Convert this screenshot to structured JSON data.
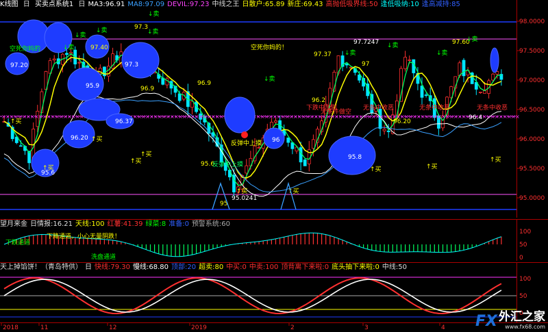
{
  "main_header": {
    "window_title": "K线图",
    "period": "日",
    "indicator_name": "买卖点系统1",
    "items": [
      {
        "text": "日",
        "color": "#dddddd"
      },
      {
        "text": "MA3:96.91",
        "color": "#ffffff"
      },
      {
        "text": "MA8:97.09",
        "color": "#3aa0ff"
      },
      {
        "text": "DEVIL:97.23",
        "color": "#ff44ff"
      },
      {
        "text": "中线之王",
        "color": "#dddddd"
      },
      {
        "text": "日散户:65.89",
        "color": "#ffff00"
      },
      {
        "text": "新庄:69.43",
        "color": "#ffff00"
      },
      {
        "text": "高抛低吸界线:50",
        "color": "#ff3030"
      },
      {
        "text": "逢低吸纳:10",
        "color": "#00ffff"
      },
      {
        "text": "逢高减持:85",
        "color": "#3060ff"
      }
    ]
  },
  "price_axis": {
    "labels": [
      "98.0000",
      "97.5000",
      "97.0000",
      "96.5000",
      "96.0000",
      "95.5000",
      "95.0000"
    ]
  },
  "price_annotations": [
    {
      "text": "97.3",
      "color": "#ffff00"
    },
    {
      "text": "97.40",
      "color": "#ffff00"
    },
    {
      "text": "97.20",
      "color": "#ffffff"
    },
    {
      "text": "95.9",
      "color": "#ffffff"
    },
    {
      "text": "97.3",
      "color": "#ffffff"
    },
    {
      "text": "96.9",
      "color": "#ffff00"
    },
    {
      "text": "96.9",
      "color": "#ffff00"
    },
    {
      "text": "96.37",
      "color": "#ffffff"
    },
    {
      "text": "96.20",
      "color": "#ffffff"
    },
    {
      "text": "95.6",
      "color": "#ffffff"
    },
    {
      "text": "95.6",
      "color": "#ffff00"
    },
    {
      "text": "96",
      "color": "#ffffff"
    },
    {
      "text": "95.0241",
      "color": "#ffffff"
    },
    {
      "text": "95",
      "color": "#ffff00"
    },
    {
      "text": "97.37",
      "color": "#ffff00"
    },
    {
      "text": "97.7247",
      "color": "#ffffff"
    },
    {
      "text": "97",
      "color": "#ffff00"
    },
    {
      "text": "97.60",
      "color": "#ffff00"
    },
    {
      "text": "96.2",
      "color": "#ffff00"
    },
    {
      "text": "95.8",
      "color": "#ffffff"
    },
    {
      "text": "96.20",
      "color": "#ffff00"
    },
    {
      "text": "96.4",
      "color": "#ffffff"
    }
  ],
  "signals": {
    "sell": [
      {
        "text": "↓卖"
      },
      {
        "text": "↓卖"
      },
      {
        "text": "↓卖"
      },
      {
        "text": "↓卖"
      },
      {
        "text": "↓卖"
      },
      {
        "text": "↓卖"
      },
      {
        "text": "↓卖"
      },
      {
        "text": "↓卖"
      },
      {
        "text": "↓卖"
      },
      {
        "text": "↓卖"
      }
    ],
    "buy": [
      {
        "text": "↑买"
      },
      {
        "text": "↑买"
      },
      {
        "text": "↑买"
      },
      {
        "text": "↑买"
      },
      {
        "text": "↑买"
      },
      {
        "text": "↑买"
      },
      {
        "text": "↑买"
      },
      {
        "text": "↑买"
      },
      {
        "text": "↑买"
      },
      {
        "text": "↑买"
      }
    ]
  },
  "text_notes": {
    "short_death": "空死你妈的！",
    "short_death_2": "空死你妈的",
    "rebound": "反弹中上摸",
    "fall_intensify": "下跌中加剧",
    "no_short": "无条件做空",
    "no_buy": "无条中收恶",
    "no_buy_2": "无条中收恶",
    "no_buy_3": "无条中收恶",
    "rebound_2": "反弹中上摸"
  },
  "panel2_header": {
    "items": [
      {
        "text": "望月来金",
        "color": "#dddddd"
      },
      {
        "text": "日情报:16.21",
        "color": "#dddddd"
      },
      {
        "text": "天线:100",
        "color": "#ffff00"
      },
      {
        "text": "红薯:41.39",
        "color": "#ff3030"
      },
      {
        "text": "绿菜:8",
        "color": "#00ff00"
      },
      {
        "text": "准备:0",
        "color": "#3060ff"
      },
      {
        "text": "预警系统:60",
        "color": "#aaaaaa"
      }
    ],
    "note_1": "下降通道，小心无量阴跌！",
    "note_2": "下跌通道",
    "note_3": "洗盘通道",
    "axis_labels": [
      "100",
      "50",
      "0"
    ]
  },
  "panel3_header": {
    "items": [
      {
        "text": "天上掉馅饼！（青岛特供）",
        "color": "#dddddd"
      },
      {
        "text": "日",
        "color": "#dddddd"
      },
      {
        "text": "快线:79.30",
        "color": "#ff3030"
      },
      {
        "text": "慢线:68.80",
        "color": "#ffffff"
      },
      {
        "text": "顶部:20",
        "color": "#3060ff"
      },
      {
        "text": "超卖:80",
        "color": "#ffff00"
      },
      {
        "text": "中买:0",
        "color": "#ff3030"
      },
      {
        "text": "中卖:100",
        "color": "#ff3030"
      },
      {
        "text": "顶背离下来啦:0",
        "color": "#ff3030"
      },
      {
        "text": "底头抽下来啦:0",
        "color": "#ffff00"
      },
      {
        "text": "中线:50",
        "color": "#dddddd"
      }
    ],
    "axis_labels": [
      "100",
      "50",
      "0"
    ]
  },
  "date_axis": {
    "labels": [
      "2018",
      "11",
      "12",
      "2019",
      "2",
      "3",
      "4"
    ]
  },
  "watermark": {
    "fx": "FX",
    "brand": "外汇之家",
    "url": "www.fx68.com"
  },
  "colors": {
    "up_candle": "#ff3030",
    "down_candle": "#00e5ff",
    "ma_yellow": "#ffff00",
    "ma_green": "#00ff60",
    "ma_white": "#ffffff",
    "ma_blue": "#3aa0ff",
    "ellipse": "#1e3cff",
    "magenta": "#ff33ff"
  }
}
